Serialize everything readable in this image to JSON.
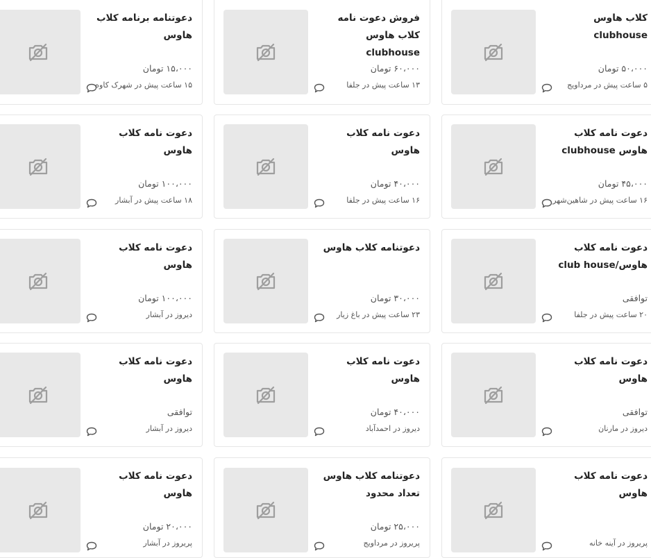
{
  "listings": [
    {
      "title": "کلاب هاوس clubhouse",
      "price": "۵۰،۰۰۰ تومان",
      "meta": "۵ ساعت پیش در مرداویج",
      "icon": "no-image-icon"
    },
    {
      "title": "فروش دعوت نامه کلاب هاوس clubhouse",
      "price": "۶۰،۰۰۰ تومان",
      "meta": "۱۳ ساعت پیش در جلفا",
      "icon": "no-image-icon"
    },
    {
      "title": "دعوتنامه برنامه کلاب هاوس",
      "price": "۱۵،۰۰۰ تومان",
      "meta": "۱۵ ساعت پیش در شهرک کاوه",
      "icon": "no-image-icon"
    },
    {
      "title": "دعوت نامه کلاب هاوس clubhouse",
      "price": "۴۵،۰۰۰ تومان",
      "meta": "۱۶ ساعت پیش در شاهین‌شهر",
      "icon": "no-image-icon"
    },
    {
      "title": "دعوت نامه کلاب هاوس",
      "price": "۴۰،۰۰۰ تومان",
      "meta": "۱۶ ساعت پیش در جلفا",
      "icon": "no-image-icon"
    },
    {
      "title": "دعوت نامه کلاب هاوس",
      "price": "۱۰۰،۰۰۰ تومان",
      "meta": "۱۸ ساعت پیش در آبشار",
      "icon": "no-image-icon"
    },
    {
      "title": "دعوت نامه کلاب هاوس/club house",
      "price": "توافقی",
      "meta": "۲۰ ساعت پیش در جلفا",
      "icon": "no-image-icon"
    },
    {
      "title": "دعوتنامه کلاب هاوس",
      "price": "۳۰،۰۰۰ تومان",
      "meta": "۲۳ ساعت پیش در باغ زیار",
      "icon": "no-image-icon"
    },
    {
      "title": "دعوت نامه کلاب هاوس",
      "price": "۱۰۰،۰۰۰ تومان",
      "meta": "دیروز در آبشار",
      "icon": "no-image-icon"
    },
    {
      "title": "دعوت نامه کلاب هاوس",
      "price": "توافقی",
      "meta": "دیروز در مارنان",
      "icon": "no-image-icon"
    },
    {
      "title": "دعوت نامه کلاب هاوس",
      "price": "۴۰،۰۰۰ تومان",
      "meta": "دیروز در احمدآباد",
      "icon": "no-image-icon"
    },
    {
      "title": "دعوت نامه کلاب هاوس",
      "price": "توافقی",
      "meta": "دیروز در آبشار",
      "icon": "no-image-icon"
    },
    {
      "title": "دعوت نامه کلاب هاوس",
      "price": "",
      "meta": "پریروز در آینه خانه",
      "icon": "no-image-icon"
    },
    {
      "title": "دعوتنامه کلاب هاوس تعداد محدود",
      "price": "۲۵،۰۰۰ تومان",
      "meta": "پریروز در مرداویج",
      "icon": "no-image-icon"
    },
    {
      "title": "دعوت نامه کلاب هاوس",
      "price": "۲۰،۰۰۰ تومان",
      "meta": "پریروز در آبشار",
      "icon": "no-image-icon"
    }
  ],
  "colors": {
    "placeholder_bg": "#e8e8e8",
    "icon": "#9e9e9e",
    "border": "#e6e6e6",
    "title": "#242424",
    "muted": "#555555"
  }
}
